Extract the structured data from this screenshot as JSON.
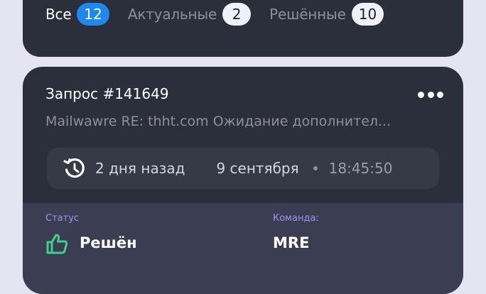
{
  "tabs": [
    {
      "label": "Все",
      "count": "12",
      "active": true
    },
    {
      "label": "Актуальные",
      "count": "2",
      "active": false
    },
    {
      "label": "Решённые",
      "count": "10",
      "active": false
    }
  ],
  "request": {
    "title": "Запрос #141649",
    "subject": "Mailwawre RE: thht.com Ожидание дополнител...",
    "time_ago": "2 дня назад",
    "date": "9 сентября",
    "time": "18:45:50",
    "status_label": "Статус",
    "status_value": "Решён",
    "team_label": "Команда:",
    "team_value": "MRE"
  },
  "colors": {
    "accent": "#1f88f0",
    "resolved_icon": "#3fd08a",
    "label": "#a58cf0"
  },
  "icons": {
    "more": "more-horizontal-icon",
    "history": "clock-history-icon",
    "status": "thumbs-up-icon"
  }
}
